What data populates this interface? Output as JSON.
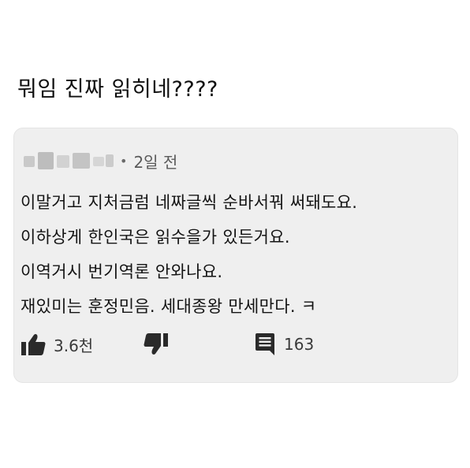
{
  "post": {
    "headline": "뭐임 진짜 읽히네????"
  },
  "comment": {
    "author_blurred": true,
    "separator": "•",
    "time": "2일 전",
    "lines": [
      "이말거고 지처금럼 네짜글씩 순바서꿔 써돼도요.",
      "이하상게 한인국은 읽수을가 있든거요.",
      "이역거시 번기역론 안와나요.",
      "재있미는 훈정민음. 세대종왕 만세만다. ㅋ"
    ],
    "likes": "3.6천",
    "replies": "163",
    "icons": {
      "like": "thumbs-up-icon",
      "dislike": "thumbs-down-icon",
      "reply": "comment-icon"
    }
  }
}
